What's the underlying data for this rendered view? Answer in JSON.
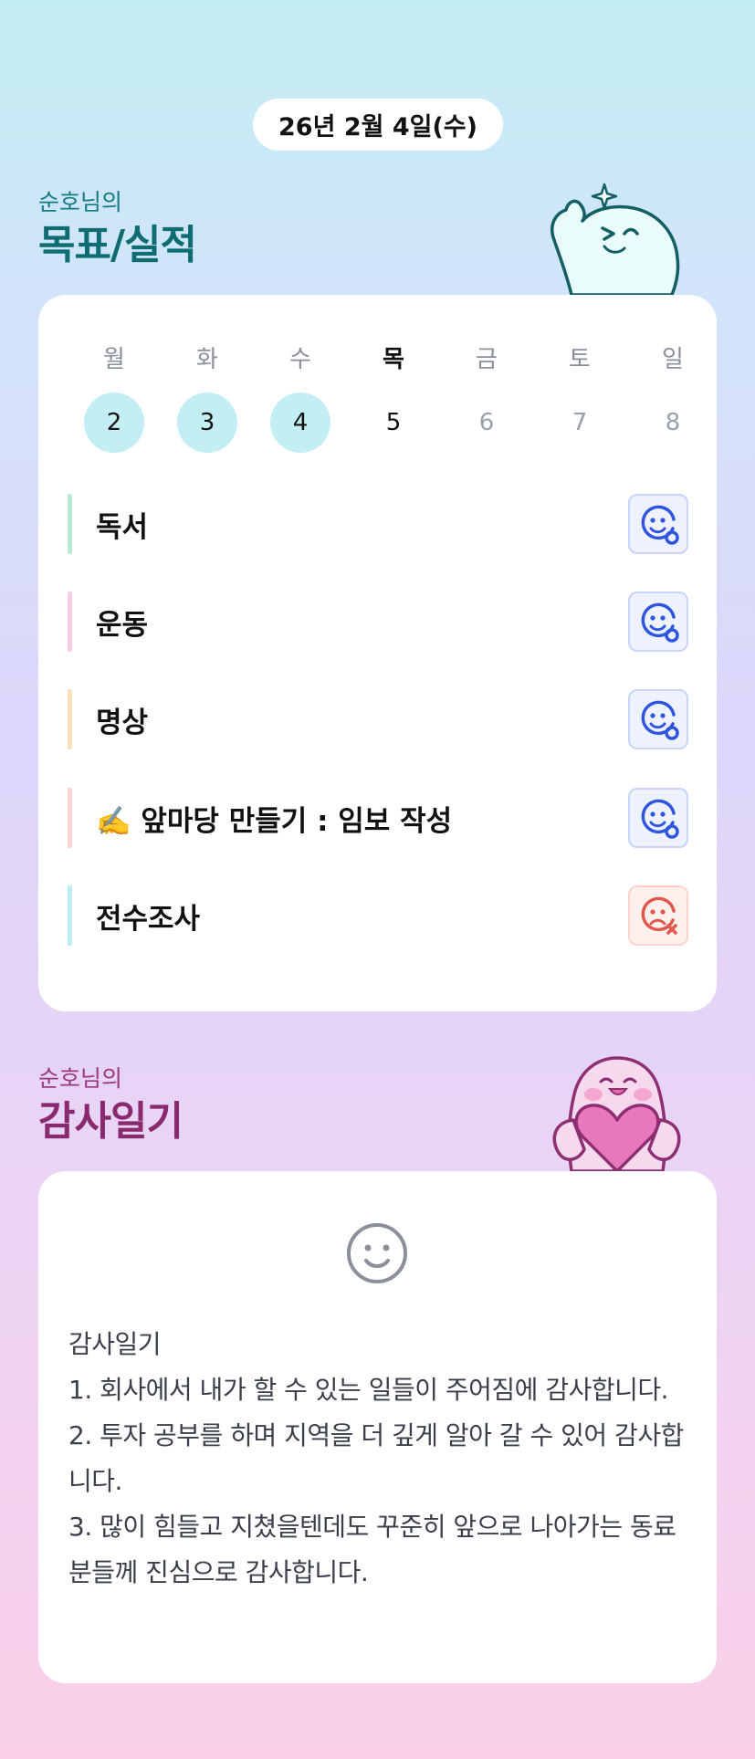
{
  "header": {
    "date": "26년 2월 4일(수)"
  },
  "goals": {
    "owner": "순호님의",
    "title": "목표/실적",
    "weekdays": [
      {
        "label": "월",
        "today": false
      },
      {
        "label": "화",
        "today": false
      },
      {
        "label": "수",
        "today": false
      },
      {
        "label": "목",
        "today": true
      },
      {
        "label": "금",
        "today": false
      },
      {
        "label": "토",
        "today": false
      },
      {
        "label": "일",
        "today": false
      }
    ],
    "dates": [
      {
        "label": "2",
        "done": true
      },
      {
        "label": "3",
        "done": true
      },
      {
        "label": "4",
        "done": true
      },
      {
        "label": "5",
        "done": false
      },
      {
        "label": "6",
        "done": false
      },
      {
        "label": "7",
        "done": false
      },
      {
        "label": "8",
        "done": false
      }
    ],
    "tasks": [
      {
        "label": "독서",
        "color": "#b6ecd3",
        "status": "done",
        "icon": "smile-check-icon"
      },
      {
        "label": "운동",
        "color": "#f9cde6",
        "status": "done",
        "icon": "smile-check-icon"
      },
      {
        "label": "명상",
        "color": "#fbe2b8",
        "status": "done",
        "icon": "smile-check-icon"
      },
      {
        "label": "✍️ 앞마당 만들기 : 임보 작성",
        "color": "#fcd2d2",
        "status": "done",
        "icon": "smile-check-icon"
      },
      {
        "label": "전수조사",
        "color": "#bdeef3",
        "status": "missed",
        "icon": "sad-x-icon"
      }
    ]
  },
  "thanks": {
    "owner": "순호님의",
    "title": "감사일기",
    "mood_icon": "neutral-smile-icon",
    "text": "감사일기\n1. 회사에서 내가 할 수 있는 일들이 주어짐에 감사합니다.\n2. 투자 공부를 하며 지역을 더 깊게 알아 갈 수 있어 감사합니다.\n3. 많이 힘들고 지쳤을텐데도 꾸준히 앞으로 나아가는 동료분들께 진심으로 감사합니다."
  },
  "colors": {
    "accent_teal": "#0f6d72",
    "accent_pink": "#8a2a6e",
    "done_circle": "#c3eef3",
    "ok_icon": "#2f55e0",
    "bad_icon": "#e2574c"
  }
}
